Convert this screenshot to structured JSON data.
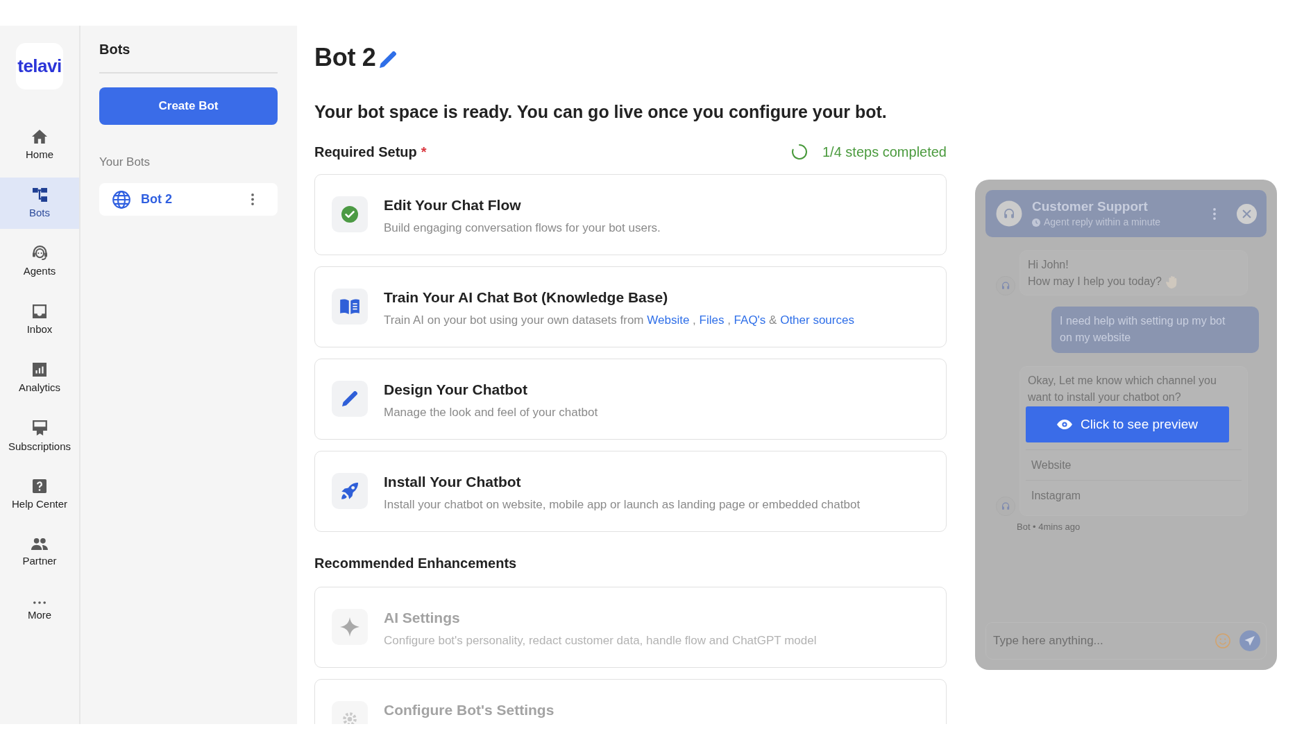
{
  "nav": {
    "logo": "telavi",
    "items": [
      {
        "label": "Home",
        "selected": false
      },
      {
        "label": "Bots",
        "selected": true
      },
      {
        "label": "Agents",
        "selected": false
      },
      {
        "label": "Inbox",
        "selected": false
      },
      {
        "label": "Analytics",
        "selected": false
      },
      {
        "label": "Subscriptions",
        "selected": false
      },
      {
        "label": "Help Center",
        "selected": false
      },
      {
        "label": "Partner",
        "selected": false
      },
      {
        "label": "More",
        "selected": false
      }
    ]
  },
  "bots_panel": {
    "title": "Bots",
    "create_button": "Create Bot",
    "section_label": "Your Bots",
    "bots": [
      {
        "name": "Bot 2",
        "selected": true
      }
    ]
  },
  "main": {
    "title": "Bot 2",
    "headline": "Your bot space is ready. You can go live once you configure your bot.",
    "required_setup": {
      "title": "Required Setup",
      "required_mark": "*",
      "progress": "1/4 steps completed",
      "steps": [
        {
          "title": "Edit Your Chat Flow",
          "completed": true,
          "description": [
            {
              "kind": "text",
              "text": "Build engaging conversation flows for your bot users."
            }
          ]
        },
        {
          "title": "Train Your AI Chat Bot (Knowledge Base)",
          "completed": false,
          "description": [
            {
              "kind": "text",
              "text": "Train AI on your bot using your own datasets from"
            },
            {
              "kind": "link",
              "text": "Website"
            },
            {
              "kind": "text",
              "text": ","
            },
            {
              "kind": "link",
              "text": "Files"
            },
            {
              "kind": "text",
              "text": ","
            },
            {
              "kind": "link",
              "text": "FAQ's"
            },
            {
              "kind": "text",
              "text": "&"
            },
            {
              "kind": "link",
              "text": "Other sources"
            }
          ]
        },
        {
          "title": "Design Your Chatbot",
          "completed": false,
          "description": [
            {
              "kind": "text",
              "text": "Manage the look and feel of your chatbot"
            }
          ]
        },
        {
          "title": "Install Your Chatbot",
          "completed": false,
          "description": [
            {
              "kind": "text",
              "text": "Install your chatbot on website, mobile app or launch as landing page or embedded chatbot"
            }
          ]
        }
      ]
    },
    "enhancements": {
      "title": "Recommended Enhancements",
      "items": [
        {
          "title": "AI Settings",
          "description": "Configure bot's personality, redact customer data, handle flow and ChatGPT model",
          "disabled": true
        },
        {
          "title": "Configure Bot's Settings",
          "disabled": true
        }
      ]
    }
  },
  "preview": {
    "header": {
      "title": "Customer Support",
      "subtitle": "Agent reply within a minute"
    },
    "messages": [
      {
        "kind": "bot",
        "lines": [
          "Hi John!",
          "How may I help you today?"
        ]
      },
      {
        "kind": "user",
        "lines": [
          "I need help with setting up my bot on my website"
        ]
      },
      {
        "kind": "bot",
        "lines": [
          "Okay, Let me know which channel you want to install your chatbot on?"
        ],
        "options": [
          "Website",
          "Instagram"
        ],
        "meta": "Bot • 4mins ago"
      }
    ],
    "preview_button": "Click to see preview",
    "input": {
      "placeholder": "Type here anything..."
    }
  }
}
